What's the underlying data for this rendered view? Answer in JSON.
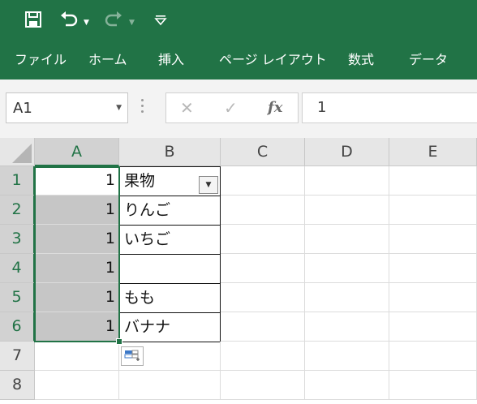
{
  "colors": {
    "brand": "#217346",
    "selected_fill": "#c6c6c6"
  },
  "quick_access": {
    "icons": [
      "save-icon",
      "undo-icon",
      "undo-dropdown-icon",
      "redo-icon",
      "redo-dropdown-icon",
      "customize-qat-icon"
    ]
  },
  "ribbon": {
    "tabs": [
      {
        "label": "ファイル"
      },
      {
        "label": "ホーム"
      },
      {
        "label": "挿入"
      },
      {
        "label": "ページ レイアウト"
      },
      {
        "label": "数式"
      },
      {
        "label": "データ"
      }
    ]
  },
  "formula_bar": {
    "name_box": "A1",
    "cancel_glyph": "✕",
    "enter_glyph": "✓",
    "fx_label": "fx",
    "value": "1"
  },
  "sheet": {
    "columns": [
      "A",
      "B",
      "C",
      "D",
      "E"
    ],
    "rows": [
      "1",
      "2",
      "3",
      "4",
      "5",
      "6",
      "7",
      "8"
    ],
    "column_a": [
      "1",
      "1",
      "1",
      "1",
      "1",
      "1"
    ],
    "column_b": [
      "果物",
      "りんご",
      "いちご",
      "",
      "もも",
      "バナナ"
    ],
    "active_cell": "A1"
  }
}
